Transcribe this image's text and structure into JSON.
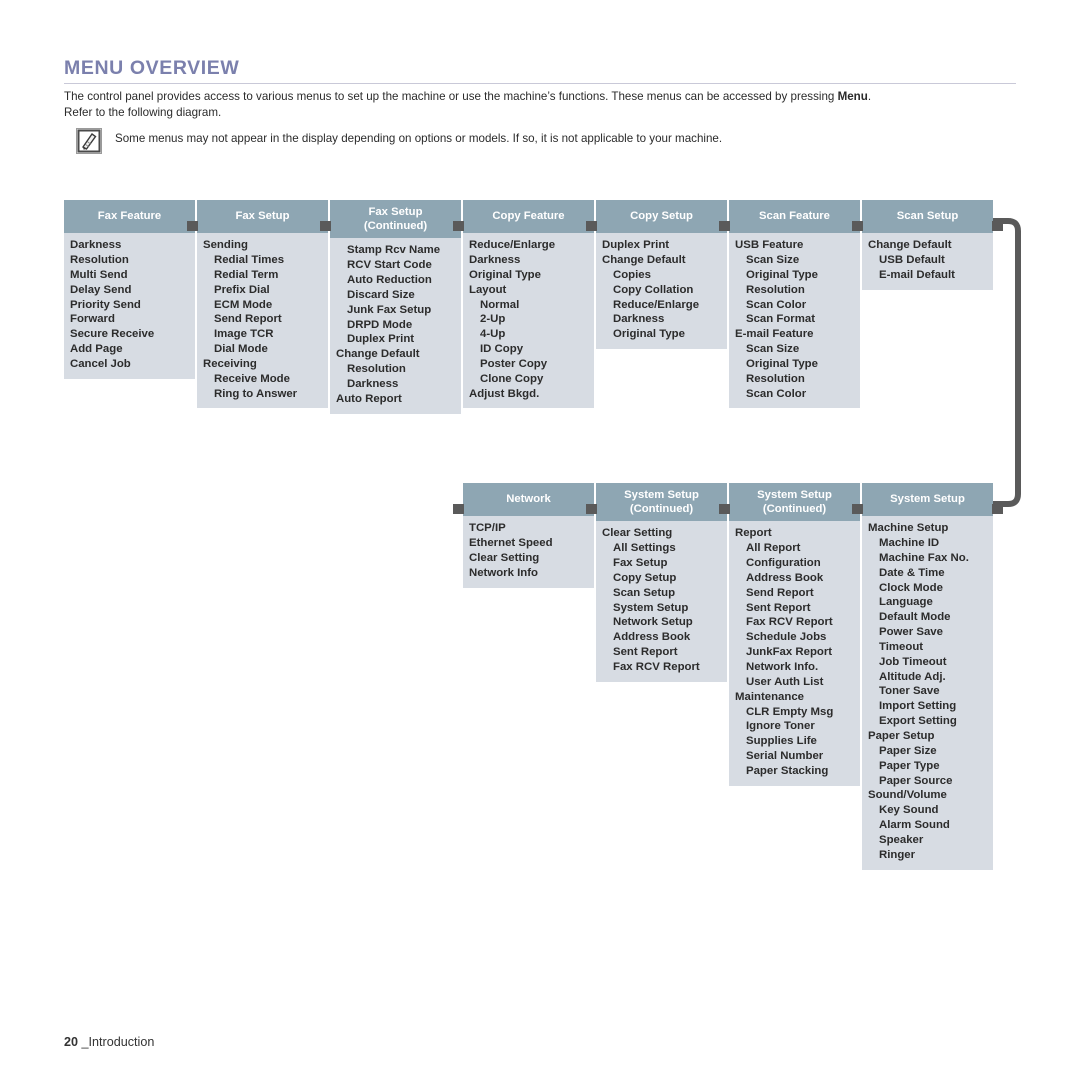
{
  "page": {
    "title": "MENU OVERVIEW",
    "intro": "The control panel provides access to various menus to set up the machine or use the machine’s functions. These menus can be accessed by pressing ",
    "intro_bold": "Menu",
    "intro_tail": ".",
    "intro_line2": "Refer to the following diagram.",
    "note": "Some menus may not appear in the display depending on options or models. If so, it is not applicable to your machine.",
    "note_icon": "note-pencil-icon",
    "footer_page": "20",
    "footer_section": "_Introduction"
  },
  "colors": {
    "title": "#7b80ad",
    "header_bg": "#8ea6b3",
    "header_text": "#ffffff",
    "body_bg": "#d7dce3",
    "connector": "#5a5a5a",
    "item_text": "#2c2c2c"
  },
  "diagram": {
    "rows": [
      {
        "columns": [
          {
            "title": "Fax Feature",
            "subtitle": "",
            "items": [
              {
                "label": "Darkness",
                "level": 1
              },
              {
                "label": "Resolution",
                "level": 1
              },
              {
                "label": "Multi Send",
                "level": 1
              },
              {
                "label": "Delay Send",
                "level": 1
              },
              {
                "label": "Priority Send",
                "level": 1
              },
              {
                "label": "Forward",
                "level": 1
              },
              {
                "label": "Secure Receive",
                "level": 1
              },
              {
                "label": "Add Page",
                "level": 1
              },
              {
                "label": "Cancel Job",
                "level": 1
              }
            ]
          },
          {
            "title": "Fax Setup",
            "subtitle": "",
            "items": [
              {
                "label": "Sending",
                "level": 1
              },
              {
                "label": "Redial Times",
                "level": 2
              },
              {
                "label": "Redial Term",
                "level": 2
              },
              {
                "label": "Prefix Dial",
                "level": 2
              },
              {
                "label": "ECM Mode",
                "level": 2
              },
              {
                "label": "Send Report",
                "level": 2
              },
              {
                "label": "Image TCR",
                "level": 2
              },
              {
                "label": "Dial Mode",
                "level": 2
              },
              {
                "label": "Receiving",
                "level": 1
              },
              {
                "label": "Receive Mode",
                "level": 2
              },
              {
                "label": "Ring to Answer",
                "level": 2
              }
            ]
          },
          {
            "title": "Fax Setup",
            "subtitle": "(Continued)",
            "items": [
              {
                "label": "Stamp Rcv Name",
                "level": 2
              },
              {
                "label": "RCV Start Code",
                "level": 2
              },
              {
                "label": "Auto Reduction",
                "level": 2
              },
              {
                "label": "Discard Size",
                "level": 2
              },
              {
                "label": "Junk Fax Setup",
                "level": 2
              },
              {
                "label": "DRPD Mode",
                "level": 2
              },
              {
                "label": "Duplex Print",
                "level": 2
              },
              {
                "label": "Change Default",
                "level": 1
              },
              {
                "label": "Resolution",
                "level": 2
              },
              {
                "label": "Darkness",
                "level": 2
              },
              {
                "label": "Auto Report",
                "level": 1
              }
            ]
          },
          {
            "title": "Copy Feature",
            "subtitle": "",
            "items": [
              {
                "label": "Reduce/Enlarge",
                "level": 1
              },
              {
                "label": "Darkness",
                "level": 1
              },
              {
                "label": "Original Type",
                "level": 1
              },
              {
                "label": "Layout",
                "level": 1
              },
              {
                "label": "Normal",
                "level": 2
              },
              {
                "label": "2-Up",
                "level": 2
              },
              {
                "label": "4-Up",
                "level": 2
              },
              {
                "label": "ID Copy",
                "level": 2
              },
              {
                "label": "Poster Copy",
                "level": 2
              },
              {
                "label": "Clone Copy",
                "level": 2
              },
              {
                "label": "Adjust Bkgd.",
                "level": 1
              }
            ]
          },
          {
            "title": "Copy Setup",
            "subtitle": "",
            "items": [
              {
                "label": "Duplex Print",
                "level": 1
              },
              {
                "label": "Change Default",
                "level": 1
              },
              {
                "label": "Copies",
                "level": 2
              },
              {
                "label": "Copy Collation",
                "level": 2
              },
              {
                "label": "Reduce/Enlarge",
                "level": 2
              },
              {
                "label": "Darkness",
                "level": 2
              },
              {
                "label": "Original Type",
                "level": 2
              }
            ]
          },
          {
            "title": "Scan Feature",
            "subtitle": "",
            "items": [
              {
                "label": "USB Feature",
                "level": 1
              },
              {
                "label": "Scan Size",
                "level": 2
              },
              {
                "label": "Original Type",
                "level": 2
              },
              {
                "label": "Resolution",
                "level": 2
              },
              {
                "label": "Scan Color",
                "level": 2
              },
              {
                "label": "Scan Format",
                "level": 2
              },
              {
                "label": "E-mail Feature",
                "level": 1
              },
              {
                "label": "Scan Size",
                "level": 2
              },
              {
                "label": "Original Type",
                "level": 2
              },
              {
                "label": "Resolution",
                "level": 2
              },
              {
                "label": "Scan Color",
                "level": 2
              }
            ]
          },
          {
            "title": "Scan Setup",
            "subtitle": "",
            "items": [
              {
                "label": "Change Default",
                "level": 1
              },
              {
                "label": "USB Default",
                "level": 2
              },
              {
                "label": "E-mail Default",
                "level": 2
              }
            ]
          }
        ]
      },
      {
        "columns": [
          {
            "title": "Network",
            "subtitle": "",
            "items": [
              {
                "label": "TCP/IP",
                "level": 1
              },
              {
                "label": "Ethernet Speed",
                "level": 1
              },
              {
                "label": "Clear Setting",
                "level": 1
              },
              {
                "label": "Network Info",
                "level": 1
              }
            ]
          },
          {
            "title": "System Setup",
            "subtitle": "(Continued)",
            "items": [
              {
                "label": "Clear Setting",
                "level": 1
              },
              {
                "label": "All Settings",
                "level": 2
              },
              {
                "label": "Fax Setup",
                "level": 2
              },
              {
                "label": "Copy Setup",
                "level": 2
              },
              {
                "label": "Scan Setup",
                "level": 2
              },
              {
                "label": "System Setup",
                "level": 2
              },
              {
                "label": "Network Setup",
                "level": 2
              },
              {
                "label": "Address Book",
                "level": 2
              },
              {
                "label": "Sent Report",
                "level": 2
              },
              {
                "label": "Fax RCV Report",
                "level": 2
              }
            ]
          },
          {
            "title": "System Setup",
            "subtitle": "(Continued)",
            "items": [
              {
                "label": "Report",
                "level": 1
              },
              {
                "label": "All Report",
                "level": 2
              },
              {
                "label": "Configuration",
                "level": 2
              },
              {
                "label": "Address Book",
                "level": 2
              },
              {
                "label": "Send Report",
                "level": 2
              },
              {
                "label": "Sent Report",
                "level": 2
              },
              {
                "label": "Fax RCV Report",
                "level": 2
              },
              {
                "label": "Schedule Jobs",
                "level": 2
              },
              {
                "label": "JunkFax Report",
                "level": 2
              },
              {
                "label": "Network Info.",
                "level": 2
              },
              {
                "label": "User Auth List",
                "level": 2
              },
              {
                "label": "Maintenance",
                "level": 1
              },
              {
                "label": "CLR Empty Msg",
                "level": 2
              },
              {
                "label": "Ignore Toner",
                "level": 2
              },
              {
                "label": "Supplies Life",
                "level": 2
              },
              {
                "label": "Serial Number",
                "level": 2
              },
              {
                "label": "Paper Stacking",
                "level": 2
              }
            ]
          },
          {
            "title": "System Setup",
            "subtitle": "",
            "items": [
              {
                "label": "Machine Setup",
                "level": 1
              },
              {
                "label": "Machine ID",
                "level": 2
              },
              {
                "label": "Machine Fax No.",
                "level": 2
              },
              {
                "label": "Date & Time",
                "level": 2
              },
              {
                "label": "Clock Mode",
                "level": 2
              },
              {
                "label": "Language",
                "level": 2
              },
              {
                "label": "Default Mode",
                "level": 2
              },
              {
                "label": "Power Save",
                "level": 2
              },
              {
                "label": "Timeout",
                "level": 2
              },
              {
                "label": "Job Timeout",
                "level": 2
              },
              {
                "label": "Altitude Adj.",
                "level": 2
              },
              {
                "label": "Toner Save",
                "level": 2
              },
              {
                "label": "Import Setting",
                "level": 2
              },
              {
                "label": "Export Setting",
                "level": 2
              },
              {
                "label": "Paper Setup",
                "level": 1
              },
              {
                "label": "Paper Size",
                "level": 2
              },
              {
                "label": "Paper Type",
                "level": 2
              },
              {
                "label": "Paper Source",
                "level": 2
              },
              {
                "label": "Sound/Volume",
                "level": 1
              },
              {
                "label": "Key Sound",
                "level": 2
              },
              {
                "label": "Alarm Sound",
                "level": 2
              },
              {
                "label": "Speaker",
                "level": 2
              },
              {
                "label": "Ringer",
                "level": 2
              }
            ]
          }
        ]
      }
    ]
  }
}
